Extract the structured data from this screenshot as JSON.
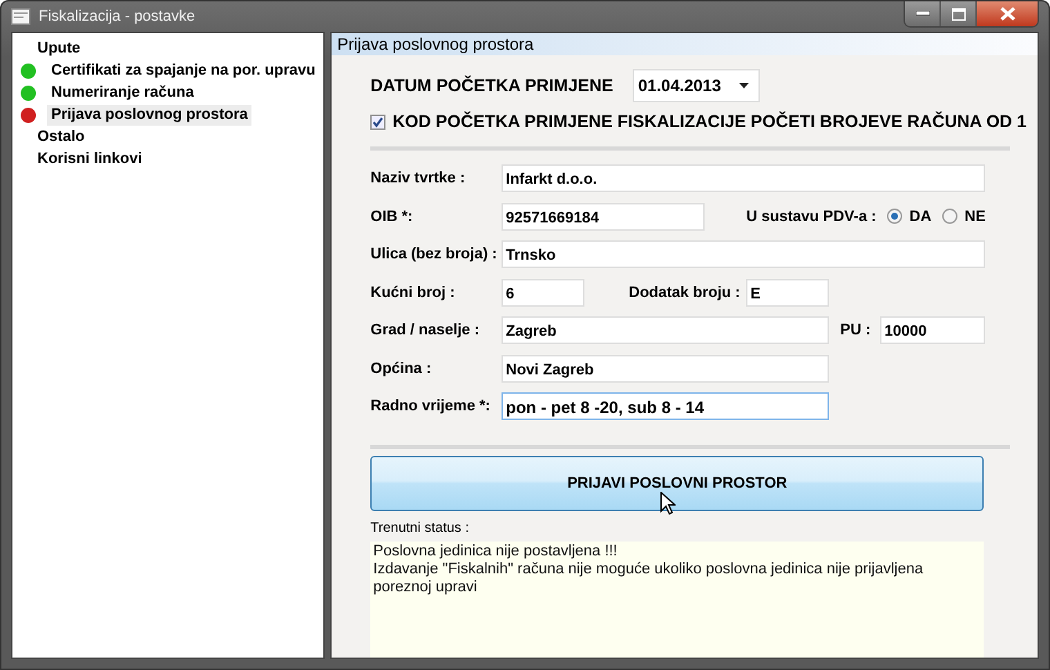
{
  "window": {
    "title": "Fiskalizacija - postavke"
  },
  "sidebar": {
    "items": [
      {
        "label": "Upute",
        "selected": false,
        "children": [
          {
            "label": "Certifikati za spajanje na por. upravu",
            "color": "#22c022",
            "selected": false
          },
          {
            "label": "Numeriranje računa",
            "color": "#22c022",
            "selected": false
          },
          {
            "label": "Prijava poslovnog prostora",
            "color": "#d02020",
            "selected": true
          }
        ]
      },
      {
        "label": "Ostalo",
        "selected": false
      },
      {
        "label": "Korisni linkovi",
        "selected": false
      }
    ]
  },
  "panel": {
    "title": "Prijava poslovnog prostora",
    "start_date": {
      "label": "DATUM POČETKA PRIMJENE",
      "value": "01.04.2013"
    },
    "restart_numbering": {
      "label": "KOD POČETKA PRIMJENE FISKALIZACIJE POČETI BROJEVE RAČUNA OD 1",
      "checked": true
    },
    "company_name": {
      "label": "Naziv tvrtke :",
      "value": "Infarkt d.o.o."
    },
    "oib": {
      "label": "OIB *:",
      "value": "92571669184"
    },
    "vat": {
      "label": "U sustavu PDV-a :",
      "options": [
        {
          "label": "DA",
          "selected": true
        },
        {
          "label": "NE",
          "selected": false
        }
      ]
    },
    "street": {
      "label": "Ulica (bez broja) :",
      "value": "Trnsko"
    },
    "house_number": {
      "label": "Kućni broj :",
      "value": "6"
    },
    "number_suffix": {
      "label": "Dodatak broju :",
      "value": "E"
    },
    "city": {
      "label": "Grad / naselje :",
      "value": "Zagreb"
    },
    "postal_code": {
      "label": "PU :",
      "value": "10000"
    },
    "municipality": {
      "label": "Općina :",
      "value": "Novi Zagreb"
    },
    "working_hours": {
      "label": "Radno vrijeme *:",
      "value": "pon - pet 8 -20, sub 8 - 14"
    },
    "submit_button": "PRIJAVI POSLOVNI PROSTOR",
    "status": {
      "label": "Trenutni status :",
      "lines": [
        "Poslovna jedinica nije postavljena !!!",
        "Izdavanje \"Fiskalnih\" računa nije moguće ukoliko poslovna jedinica nije prijavljena poreznoj upravi"
      ]
    }
  }
}
